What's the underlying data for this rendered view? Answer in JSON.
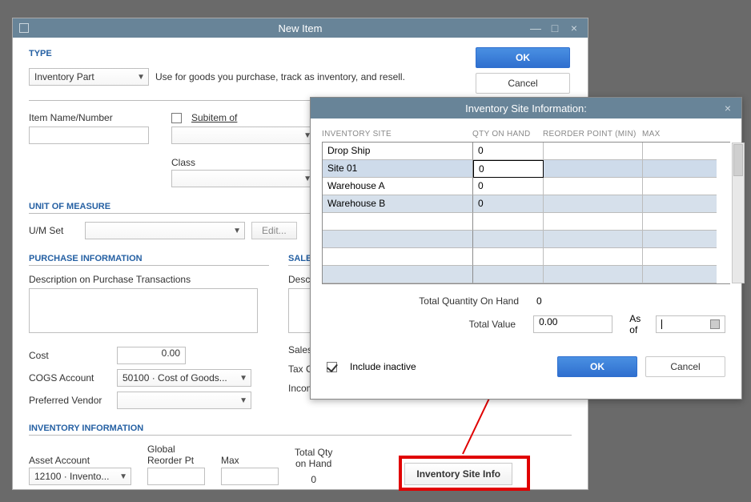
{
  "main_window": {
    "title": "New Item",
    "win_min": "—",
    "win_box": "□",
    "win_close": "×",
    "ok_label": "OK",
    "cancel_label": "Cancel",
    "type_section": "TYPE",
    "type_value": "Inventory Part",
    "type_hint": "Use for goods you purchase, track as inventory, and resell.",
    "item_name_label": "Item Name/Number",
    "subitem_label": "Subitem of",
    "class_label": "Class",
    "uom_section": "UNIT OF MEASURE",
    "uom_label": "U/M Set",
    "uom_edit": "Edit...",
    "purchase_section": "PURCHASE INFORMATION",
    "purchase_desc_label": "Description on Purchase Transactions",
    "cost_label": "Cost",
    "cost_value": "0.00",
    "cogs_label": "COGS Account",
    "cogs_value": "50100 · Cost of Goods...",
    "pref_vendor_label": "Preferred Vendor",
    "sales_section": "SALES I",
    "sales_desc_label": "Descrip",
    "sales_price_label": "Sales P",
    "tax_code_label": "Tax Co",
    "income_label": "Income",
    "inventory_section": "INVENTORY INFORMATION",
    "asset_label": "Asset Account",
    "asset_value": "12100 · Invento...",
    "global_reorder_label_1": "Global",
    "global_reorder_label_2": "Reorder Pt",
    "max_label": "Max",
    "total_qty_label_1": "Total Qty",
    "total_qty_label_2": "on Hand",
    "total_qty_value": "0",
    "site_info_btn": "Inventory Site Info"
  },
  "modal": {
    "title": "Inventory Site Information:",
    "col_site": "INVENTORY SITE",
    "col_qty": "QTY ON HAND",
    "col_rp": "REORDER POINT (MIN)",
    "col_max": "MAX",
    "rows": [
      {
        "site": "Drop Ship",
        "qty": "0"
      },
      {
        "site": "Site 01",
        "qty": "0"
      },
      {
        "site": "Warehouse A",
        "qty": "0"
      },
      {
        "site": "Warehouse B",
        "qty": "0"
      }
    ],
    "total_qty_label": "Total Quantity On Hand",
    "total_qty_value": "0",
    "total_value_label": "Total Value",
    "total_value": "0.00",
    "asof_label": "As of",
    "include_inactive_label": "Include inactive",
    "ok_label": "OK",
    "cancel_label": "Cancel"
  }
}
